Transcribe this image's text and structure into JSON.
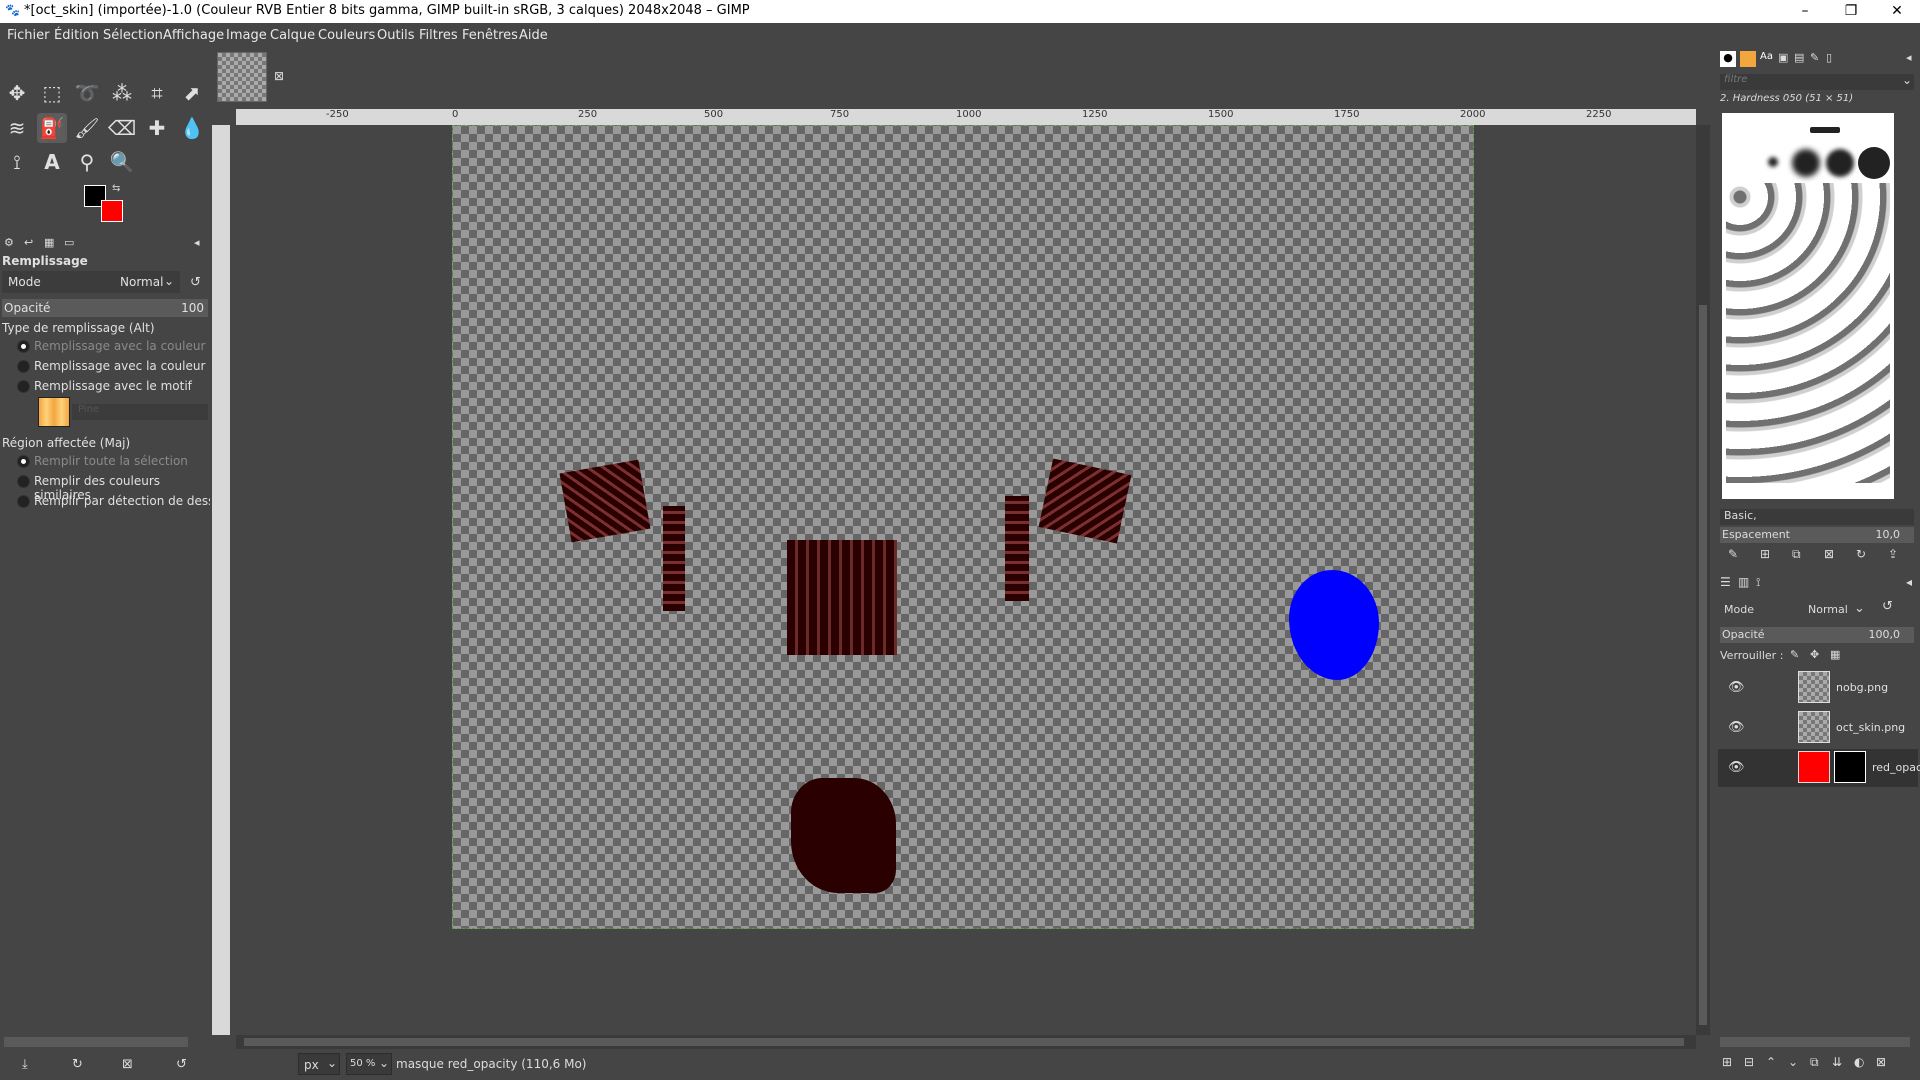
{
  "window": {
    "title": "*[oct_skin] (importée)-1.0 (Couleur RVB Entier 8 bits gamma, GIMP built-in sRGB, 3 calques) 2048x2048 – GIMP",
    "minimize": "–",
    "maximize": "❐",
    "close": "✕"
  },
  "menu": [
    "Fichier",
    "Édition",
    "Sélection",
    "Affichage",
    "Image",
    "Calque",
    "Couleurs",
    "Outils",
    "Filtres",
    "Fenêtres",
    "Aide"
  ],
  "tool_options": {
    "title": "Remplissage",
    "mode_label": "Mode",
    "mode_value": "Normal",
    "opacity_label": "Opacité",
    "opacity_value": "100",
    "fill_type_label": "Type de remplissage (Alt)",
    "fill_options": [
      "Remplissage avec la couleur de PP",
      "Remplissage avec la couleur d'AP",
      "Remplissage avec le motif"
    ],
    "pattern_name": "Pine",
    "region_label": "Région affectée (Maj)",
    "region_options": [
      "Remplir toute la sélection",
      "Remplir des couleurs similaires",
      "Remplir par détection de dessin au"
    ]
  },
  "rulers": {
    "h_ticks": [
      "-250",
      "0",
      "250",
      "500",
      "750",
      "1000",
      "1250",
      "1500",
      "1750",
      "2000",
      "2250"
    ]
  },
  "status": {
    "unit": "px",
    "zoom": "50 %",
    "message": "masque red_opacity (110,6 Mo)"
  },
  "brushes": {
    "filter_placeholder": "filtre",
    "selected": "2. Hardness 050 (51 × 51)",
    "tag": "Basic,",
    "spacing_label": "Espacement",
    "spacing_value": "10,0"
  },
  "layers_panel": {
    "mode_label": "Mode",
    "mode_value": "Normal",
    "opacity_label": "Opacité",
    "opacity_value": "100,0",
    "lock_label": "Verrouiller :",
    "layers": [
      {
        "name": "nobg.png"
      },
      {
        "name": "oct_skin.png"
      },
      {
        "name": "red_opac"
      }
    ]
  },
  "colors": {
    "foreground": "#000000",
    "background": "#ff0000",
    "blob": "#0000ff",
    "glyph": "#2a0000"
  }
}
